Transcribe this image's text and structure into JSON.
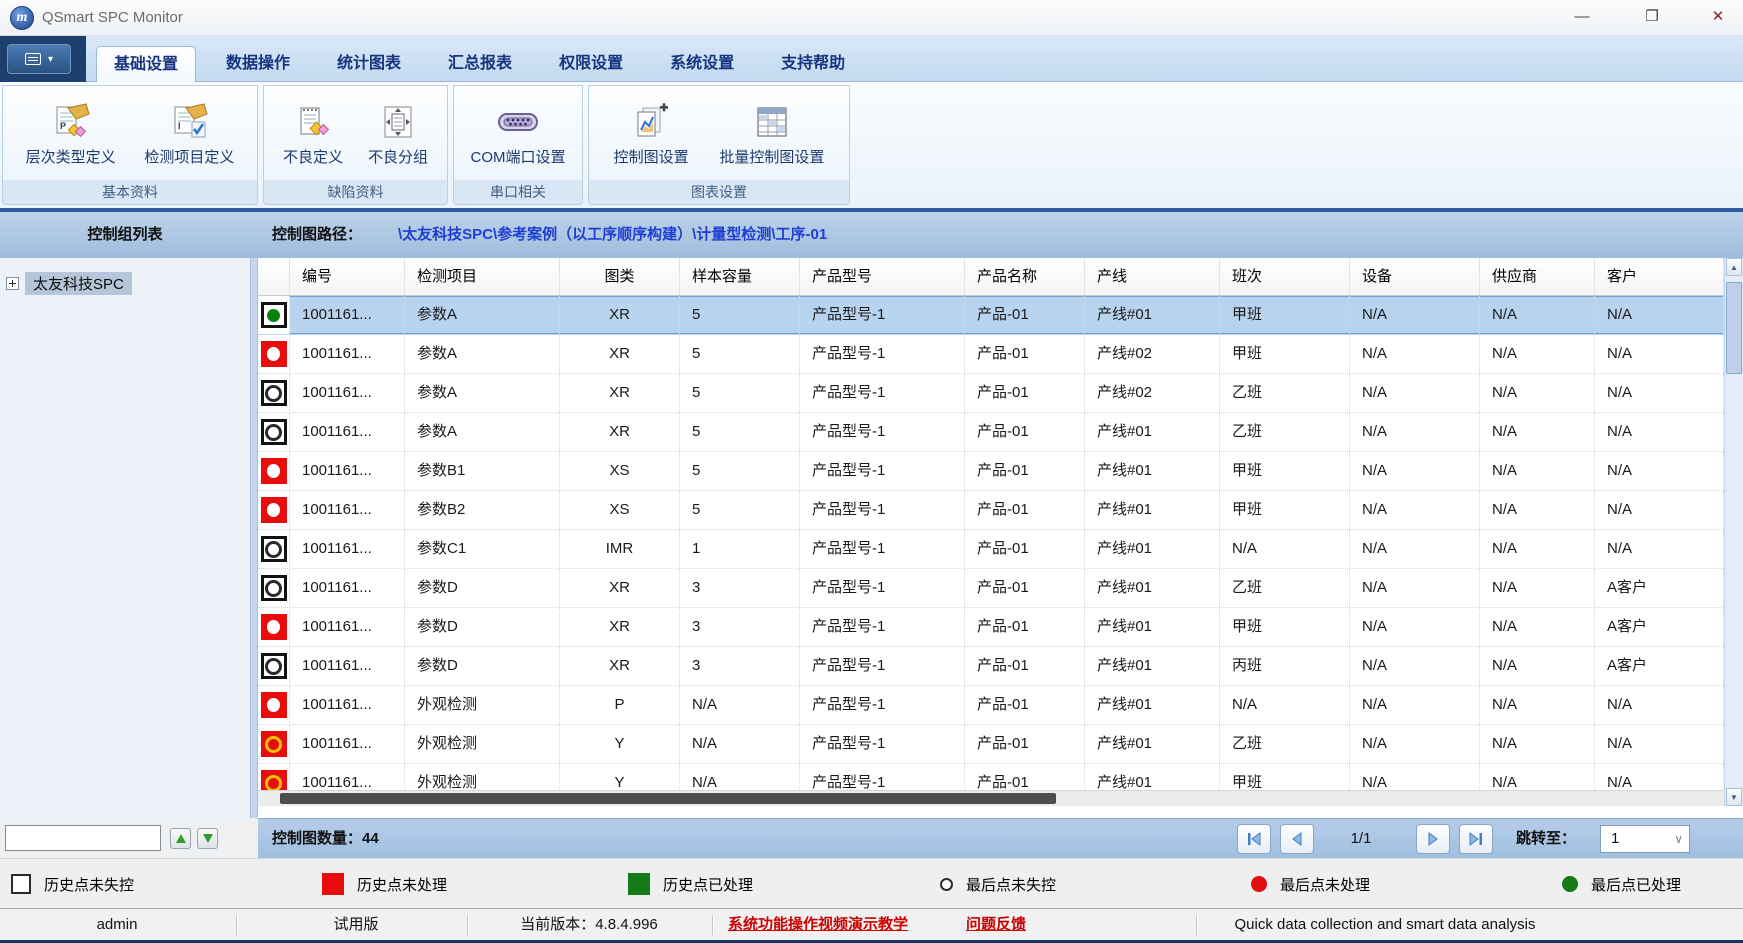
{
  "window": {
    "title": "QSmart SPC Monitor"
  },
  "icons": {
    "minimize": "—",
    "maximize": "❐",
    "close": "✕",
    "menu_caret": "▾",
    "scroll_up": "▲",
    "scroll_down": "▼",
    "dropdown_chevron": "∨"
  },
  "menu": {
    "tabs": [
      "基础设置",
      "数据操作",
      "统计图表",
      "汇总报表",
      "权限设置",
      "系统设置",
      "支持帮助"
    ],
    "active_tab": "基础设置"
  },
  "ribbon": {
    "groups": [
      {
        "label": "基本资料",
        "buttons": [
          {
            "label": "层次类型定义",
            "icon": "hierarchy-type-icon"
          },
          {
            "label": "检测项目定义",
            "icon": "inspection-item-icon"
          }
        ]
      },
      {
        "label": "缺陷资料",
        "buttons": [
          {
            "label": "不良定义",
            "icon": "defect-define-icon"
          },
          {
            "label": "不良分组",
            "icon": "defect-group-icon"
          }
        ]
      },
      {
        "label": "串口相关",
        "buttons": [
          {
            "label": "COM端口设置",
            "icon": "com-port-icon"
          }
        ]
      },
      {
        "label": "图表设置",
        "buttons": [
          {
            "label": "控制图设置",
            "icon": "control-chart-icon"
          },
          {
            "label": "批量控制图设置",
            "icon": "batch-control-chart-icon"
          }
        ]
      }
    ]
  },
  "control_bar": {
    "group_list_title": "控制组列表",
    "path_label": "控制图路径：",
    "path_value": "\\太友科技SPC\\参考案例（以工序顺序构建）\\计量型检测\\工序-01"
  },
  "sidebar": {
    "root_node": "太友科技SPC"
  },
  "table": {
    "headers": [
      "编号",
      "检测项目",
      "图类",
      "样本容量",
      "产品型号",
      "产品名称",
      "产线",
      "班次",
      "设备",
      "供应商",
      "客户"
    ],
    "rows": [
      {
        "status": "green-dot",
        "selected": true,
        "cells": [
          "1001161...",
          "参数A",
          "XR",
          "5",
          "产品型号-1",
          "产品-01",
          "产线#01",
          "甲班",
          "N/A",
          "N/A",
          "N/A"
        ]
      },
      {
        "status": "red-dot",
        "selected": false,
        "cells": [
          "1001161...",
          "参数A",
          "XR",
          "5",
          "产品型号-1",
          "产品-01",
          "产线#02",
          "甲班",
          "N/A",
          "N/A",
          "N/A"
        ]
      },
      {
        "status": "ring",
        "selected": false,
        "cells": [
          "1001161...",
          "参数A",
          "XR",
          "5",
          "产品型号-1",
          "产品-01",
          "产线#02",
          "乙班",
          "N/A",
          "N/A",
          "N/A"
        ]
      },
      {
        "status": "ring",
        "selected": false,
        "cells": [
          "1001161...",
          "参数A",
          "XR",
          "5",
          "产品型号-1",
          "产品-01",
          "产线#01",
          "乙班",
          "N/A",
          "N/A",
          "N/A"
        ]
      },
      {
        "status": "red-dot",
        "selected": false,
        "cells": [
          "1001161...",
          "参数B1",
          "XS",
          "5",
          "产品型号-1",
          "产品-01",
          "产线#01",
          "甲班",
          "N/A",
          "N/A",
          "N/A"
        ]
      },
      {
        "status": "red-dot",
        "selected": false,
        "cells": [
          "1001161...",
          "参数B2",
          "XS",
          "5",
          "产品型号-1",
          "产品-01",
          "产线#01",
          "甲班",
          "N/A",
          "N/A",
          "N/A"
        ]
      },
      {
        "status": "ring",
        "selected": false,
        "cells": [
          "1001161...",
          "参数C1",
          "IMR",
          "1",
          "产品型号-1",
          "产品-01",
          "产线#01",
          "N/A",
          "N/A",
          "N/A",
          "N/A"
        ]
      },
      {
        "status": "ring",
        "selected": false,
        "cells": [
          "1001161...",
          "参数D",
          "XR",
          "3",
          "产品型号-1",
          "产品-01",
          "产线#01",
          "乙班",
          "N/A",
          "N/A",
          "A客户"
        ]
      },
      {
        "status": "red-dot",
        "selected": false,
        "cells": [
          "1001161...",
          "参数D",
          "XR",
          "3",
          "产品型号-1",
          "产品-01",
          "产线#01",
          "甲班",
          "N/A",
          "N/A",
          "A客户"
        ]
      },
      {
        "status": "ring",
        "selected": false,
        "cells": [
          "1001161...",
          "参数D",
          "XR",
          "3",
          "产品型号-1",
          "产品-01",
          "产线#01",
          "丙班",
          "N/A",
          "N/A",
          "A客户"
        ]
      },
      {
        "status": "red-dot",
        "selected": false,
        "cells": [
          "1001161...",
          "外观检测",
          "P",
          "N/A",
          "产品型号-1",
          "产品-01",
          "产线#01",
          "N/A",
          "N/A",
          "N/A",
          "N/A"
        ]
      },
      {
        "status": "yellow-ring",
        "selected": false,
        "cells": [
          "1001161...",
          "外观检测",
          "Y",
          "N/A",
          "产品型号-1",
          "产品-01",
          "产线#01",
          "乙班",
          "N/A",
          "N/A",
          "N/A"
        ]
      },
      {
        "status": "yellow-ring",
        "selected": false,
        "cells": [
          "1001161...",
          "外观检测",
          "Y",
          "N/A",
          "产品型号-1",
          "产品-01",
          "产线#01",
          "甲班",
          "N/A",
          "N/A",
          "N/A"
        ]
      }
    ]
  },
  "pagination": {
    "count_label": "控制图数量：44",
    "page_indicator": "1/1",
    "jump_label": "跳转至：",
    "jump_value": "1"
  },
  "legend": {
    "items": [
      {
        "swatch": "square-outline",
        "label": "历史点未失控"
      },
      {
        "swatch": "square-red",
        "label": "历史点未处理"
      },
      {
        "swatch": "square-green",
        "label": "历史点已处理"
      },
      {
        "swatch": "circle-outline",
        "label": "最后点未失控"
      },
      {
        "swatch": "circle-red",
        "label": "最后点未处理"
      },
      {
        "swatch": "circle-green",
        "label": "最后点已处理"
      }
    ]
  },
  "statusbar": {
    "items": [
      {
        "text": "admin",
        "link": false
      },
      {
        "text": "试用版",
        "link": false
      },
      {
        "text": "当前版本：4.8.4.996",
        "link": false
      },
      {
        "text": "系统功能操作视频演示教学",
        "link": true
      },
      {
        "text": "问题反馈",
        "link": true
      },
      {
        "text": "Quick data collection and smart data analysis",
        "link": false
      }
    ]
  },
  "colors": {
    "selected_row": "#b8d3ee",
    "status_red": "#e80c0c",
    "status_green": "#0b830b",
    "legend_green": "#167a16",
    "link_red": "#cc0000",
    "bar_blue": "#a9c4e2",
    "ribbon_separator": "#2e5c9e"
  }
}
